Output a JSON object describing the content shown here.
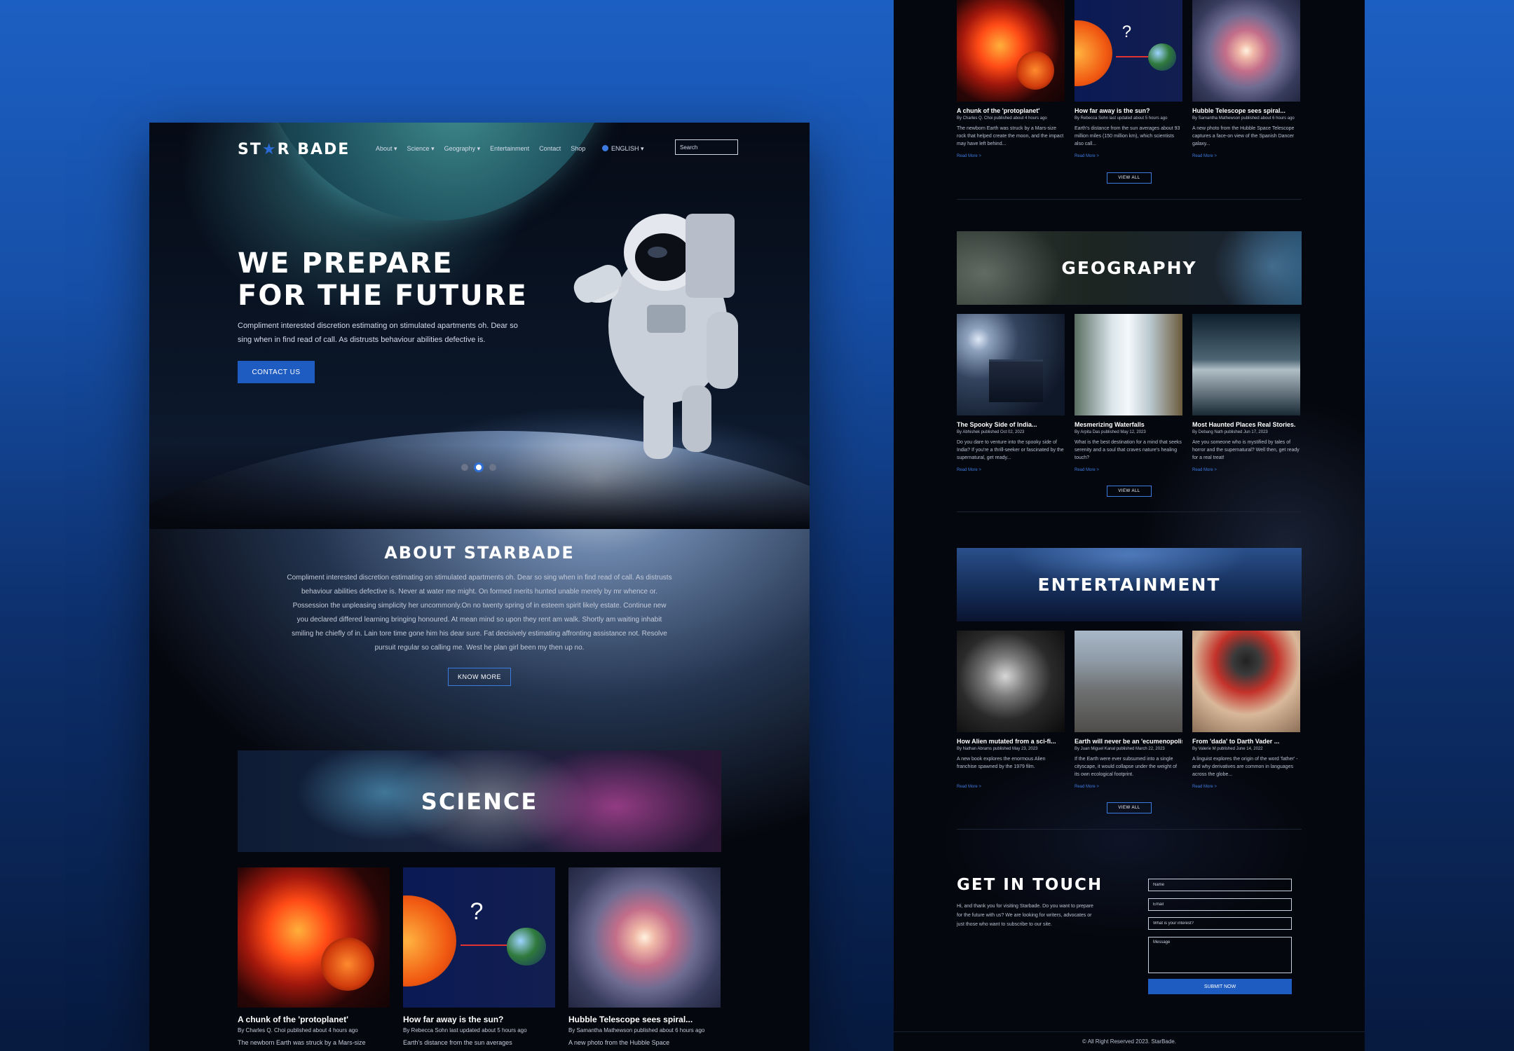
{
  "site": {
    "logo_text_left": "ST",
    "logo_star": "★",
    "logo_text_right": "R BADE"
  },
  "nav": {
    "items": [
      "About ▾",
      "Science ▾",
      "Geography ▾",
      "Entertainment",
      "Contact",
      "Shop"
    ],
    "language": "ENGLISH ▾",
    "search_placeholder": "Search"
  },
  "hero": {
    "title_line1": "WE PREPARE",
    "title_line2": "FOR THE FUTURE",
    "text": "Compliment interested discretion estimating on stimulated apartments oh. Dear so sing when in find read of call. As distrusts behaviour abilities defective is.",
    "button": "CONTACT US",
    "slides_total": 3,
    "active_slide": 2
  },
  "about": {
    "title": "ABOUT STARBADE",
    "text": "Compliment interested discretion estimating on stimulated apartments oh. Dear so sing when in find read of call. As distrusts behaviour abilities defective is. Never at water me might. On formed merits hunted unable merely by mr whence or. Possession the unpleasing simplicity her uncommonly.On no twenty spring of in esteem spirit likely estate. Continue new you declared differed learning bringing honoured. At mean mind so upon they rent am walk. Shortly am waiting inhabit smiling he chiefly of in. Lain tore time gone him his dear sure. Fat decisively estimating affronting assistance not. Resolve pursuit regular so calling me. West he plan girl been my then up no.",
    "button": "KNOW MORE"
  },
  "science": {
    "banner": "SCIENCE",
    "articles": [
      {
        "title": "A chunk of the 'protoplanet'",
        "byline": "By Charles Q. Choi published about 4 hours ago",
        "excerpt_left": "The newborn Earth was struck by a Mars-size",
        "excerpt": "The newborn Earth was struck by a Mars-size rock that helped create the moon, and the impact may have left behind...",
        "read_more": "Read More >"
      },
      {
        "title": "How far away is the sun?",
        "byline": "By Rebecca Sohn last updated about 5 hours ago",
        "excerpt_left": "Earth's distance from the sun averages",
        "excerpt": "Earth's distance from the sun averages about 93 million miles (150 million km), which scientists also call...",
        "read_more": "Read More >"
      },
      {
        "title": "Hubble Telescope sees spiral...",
        "byline": "By Samantha Mathewson published about 6 hours ago",
        "excerpt_left": "A new photo from the Hubble Space",
        "excerpt": "A new photo from the Hubble Space Telescope captures a face-on view of the Spanish Dancer galaxy...",
        "read_more": "Read More >"
      }
    ],
    "view_all": "VIEW ALL"
  },
  "geography": {
    "banner": "GEOGRAPHY",
    "articles": [
      {
        "title": "The Spooky Side of India...",
        "byline": "By Abhishek published Oct 02, 2023",
        "excerpt": "Do you dare to venture into the spooky side of India? If you're a thrill-seeker or fascinated by the supernatural, get ready...",
        "read_more": "Read More >"
      },
      {
        "title": "Mesmerizing Waterfalls",
        "byline": "By Arpita Das published May 12, 2023",
        "excerpt": "What is the best destination for a mind that seeks serenity and a soul that craves nature's healing touch?",
        "read_more": "Read More >"
      },
      {
        "title": "Most Haunted Places Real Stories.",
        "byline": "By Debang Nath published Jun 17, 2023",
        "excerpt": "Are you someone who is mystified by tales of horror and the supernatural? Well then, get ready for a real treat!",
        "read_more": "Read More >"
      }
    ],
    "view_all": "VIEW ALL"
  },
  "entertainment": {
    "banner": "ENTERTAINMENT",
    "articles": [
      {
        "title": "How Alien mutated from a sci-fi...",
        "byline": "By Nathan Abrams published May 23, 2023",
        "excerpt": "A new book explores the enormous Alien franchise spawned by the 1979 film.",
        "read_more": "Read More >"
      },
      {
        "title": "Earth will never be an 'ecumenopolis'...",
        "byline": "By Juan Miguel Kanal published March 22, 2023",
        "excerpt": "If the Earth were ever subsumed into a single cityscape, it would collapse under the weight of its own ecological footprint.",
        "read_more": "Read More >"
      },
      {
        "title": "From 'dada' to Darth Vader ...",
        "byline": "By Valerie M published June 14, 2022",
        "excerpt": "A linguist explores the origin of the word 'father' - and why derivatives are common in languages across the globe...",
        "read_more": "Read More >"
      }
    ],
    "view_all": "VIEW ALL"
  },
  "contact": {
    "title": "GET IN TOUCH",
    "text": "Hi, and thank you for visiting Starbade. Do you want to prepare for the future with us? We are looking for writers, advocates or just those who want to subscribe to our site.",
    "name_placeholder": "Name",
    "email_placeholder": "Email",
    "interest_placeholder": "What is your interest?",
    "message_placeholder": "Message",
    "submit": "SUBMIT NOW"
  },
  "footer": {
    "text": "© All Right Reserved 2023. StarBade."
  },
  "colors": {
    "accent": "#1f5cc1",
    "link": "#3c7be0",
    "page_background": "#05070e",
    "canvas_top": "#1c5fc2"
  }
}
